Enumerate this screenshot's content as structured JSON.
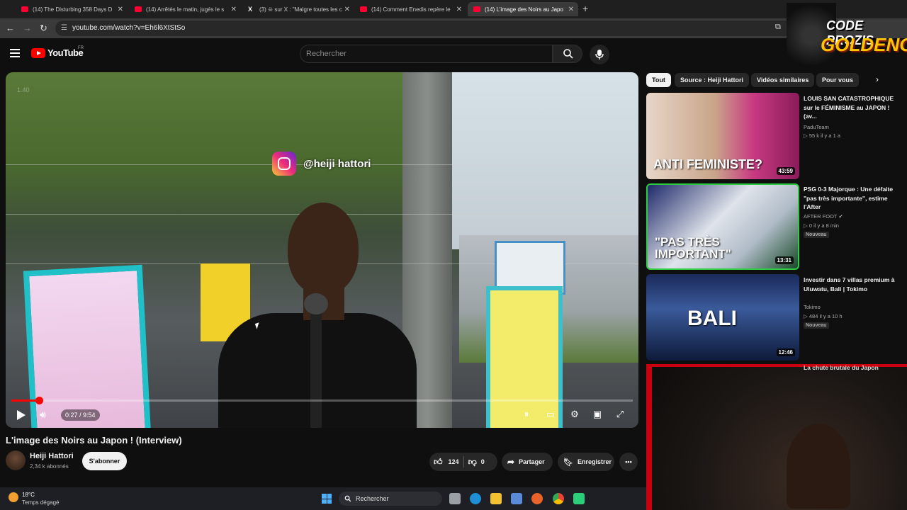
{
  "browser": {
    "tabs": [
      {
        "label": "(14) The Disturbing 358 Days D",
        "icon": "youtube-icon"
      },
      {
        "label": "(14) Arrêtés le matin, jugés le s",
        "icon": "youtube-icon"
      },
      {
        "label": "(3) ☠ sur X : \"Malgre toutes les c",
        "icon": "x-icon"
      },
      {
        "label": "(14) Comment Enedis repère le",
        "icon": "youtube-icon"
      },
      {
        "label": "(14) L'image des Noirs au Japo",
        "icon": "youtube-icon"
      }
    ],
    "url": "youtube.com/watch?v=Eh6l6XtStSo"
  },
  "youtube": {
    "logo": "YouTube",
    "country": "FR",
    "search_placeholder": "Rechercher"
  },
  "video": {
    "overlay_handle": "@heiji hattori",
    "overlay_id": "1.40",
    "current_time": "0:27",
    "duration": "9:54",
    "time_display": "0:27 / 9:54",
    "progress_fraction": 0.045,
    "title": "L'image des Noirs au Japon ! (Interview)",
    "channel": "Heiji Hattori",
    "subscribers": "2,34 k abonnés",
    "subscribe_label": "S'abonner",
    "likes": "124",
    "dislikes": "0",
    "share_label": "Partager",
    "save_label": "Enregistrer"
  },
  "chips": [
    "Tout",
    "Source : Heiji Hattori",
    "Vidéos similaires",
    "Pour vous"
  ],
  "recommendations": [
    {
      "title": "LOUIS SAN CATASTROPHIQUE sur le FÉMINISME au JAPON ! (av...",
      "channel": "PaduTeam",
      "views": "55 k",
      "age": "il y a 1 a",
      "meta": "▷ 55 k   il y a 1 a",
      "duration": "43:59",
      "thumb_text": "ANTI FEMINISTE?",
      "badge": ""
    },
    {
      "title": "PSG 0-3 Majorque : Une défaite \"pas très importante\", estime l'After",
      "channel": "AFTER FOOT ✔",
      "views": "0",
      "age": "il y a 8 min",
      "meta": "▷ 0   il y a 8 min",
      "duration": "13:31",
      "thumb_text": "\"PAS TRÈS IMPORTANT\"",
      "badge": "Nouveau"
    },
    {
      "title": "Investir dans 7 villas premium à Uluwatu, Bali | Tokimo",
      "channel": "Tokimo",
      "views": "484",
      "age": "il y a 10 h",
      "meta": "▷ 484   il y a 10 h",
      "duration": "12:46",
      "thumb_text": "BALI",
      "badge": "Nouveau"
    }
  ],
  "partial_rec_title": "La chute brutale du Japon",
  "promo": {
    "line1": "CODE PROZIS",
    "line2": "GOLDENG"
  },
  "taskbar": {
    "temperature": "18°C",
    "weather": "Temps dégagé",
    "search_label": "Rechercher"
  },
  "colors": {
    "yt_red": "#ff0000",
    "background": "#0f0f0f",
    "chip_bg": "#272727"
  }
}
